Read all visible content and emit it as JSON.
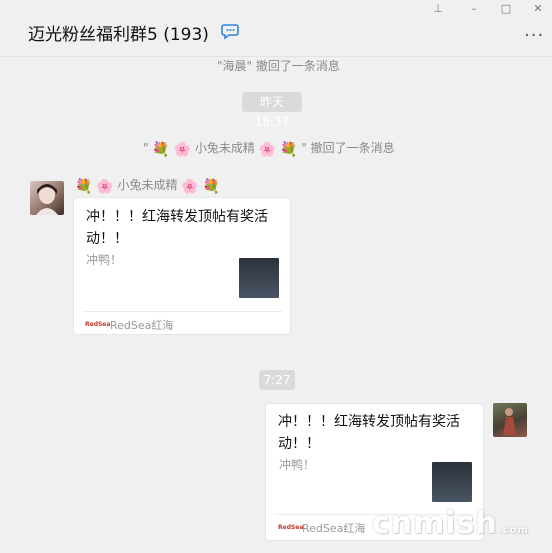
{
  "window": {
    "title": "迈光粉丝福利群5 (193)",
    "controls": {
      "pin": "⊥",
      "minimize": "–",
      "maximize": "□",
      "close": "✕"
    },
    "more": "···"
  },
  "messages": {
    "recall_1": "\"海晨\" 撤回了一条消息",
    "time_1": "昨天 18:37",
    "recall_2": {
      "quote_open": "\"",
      "name": "小兔未成精",
      "text": "\" 撤回了一条消息"
    },
    "incoming": {
      "sender": "小兔未成精",
      "card": {
        "title": "冲！！！红海转发顶帖有奖活动！！",
        "desc": "冲鸭！",
        "logo_text": "RedSea",
        "source": "RedSea红海"
      }
    },
    "time_2": "7:27",
    "outgoing": {
      "card": {
        "title": "冲！！！红海转发顶帖有奖活动！！",
        "desc": "冲鸭！",
        "logo_text": "RedSea",
        "source": "RedSea红海"
      }
    }
  },
  "icons": {
    "bouquet": "💐",
    "blossom": "🌸"
  },
  "watermark": {
    "main": "cnmish",
    "suffix": ".com"
  }
}
